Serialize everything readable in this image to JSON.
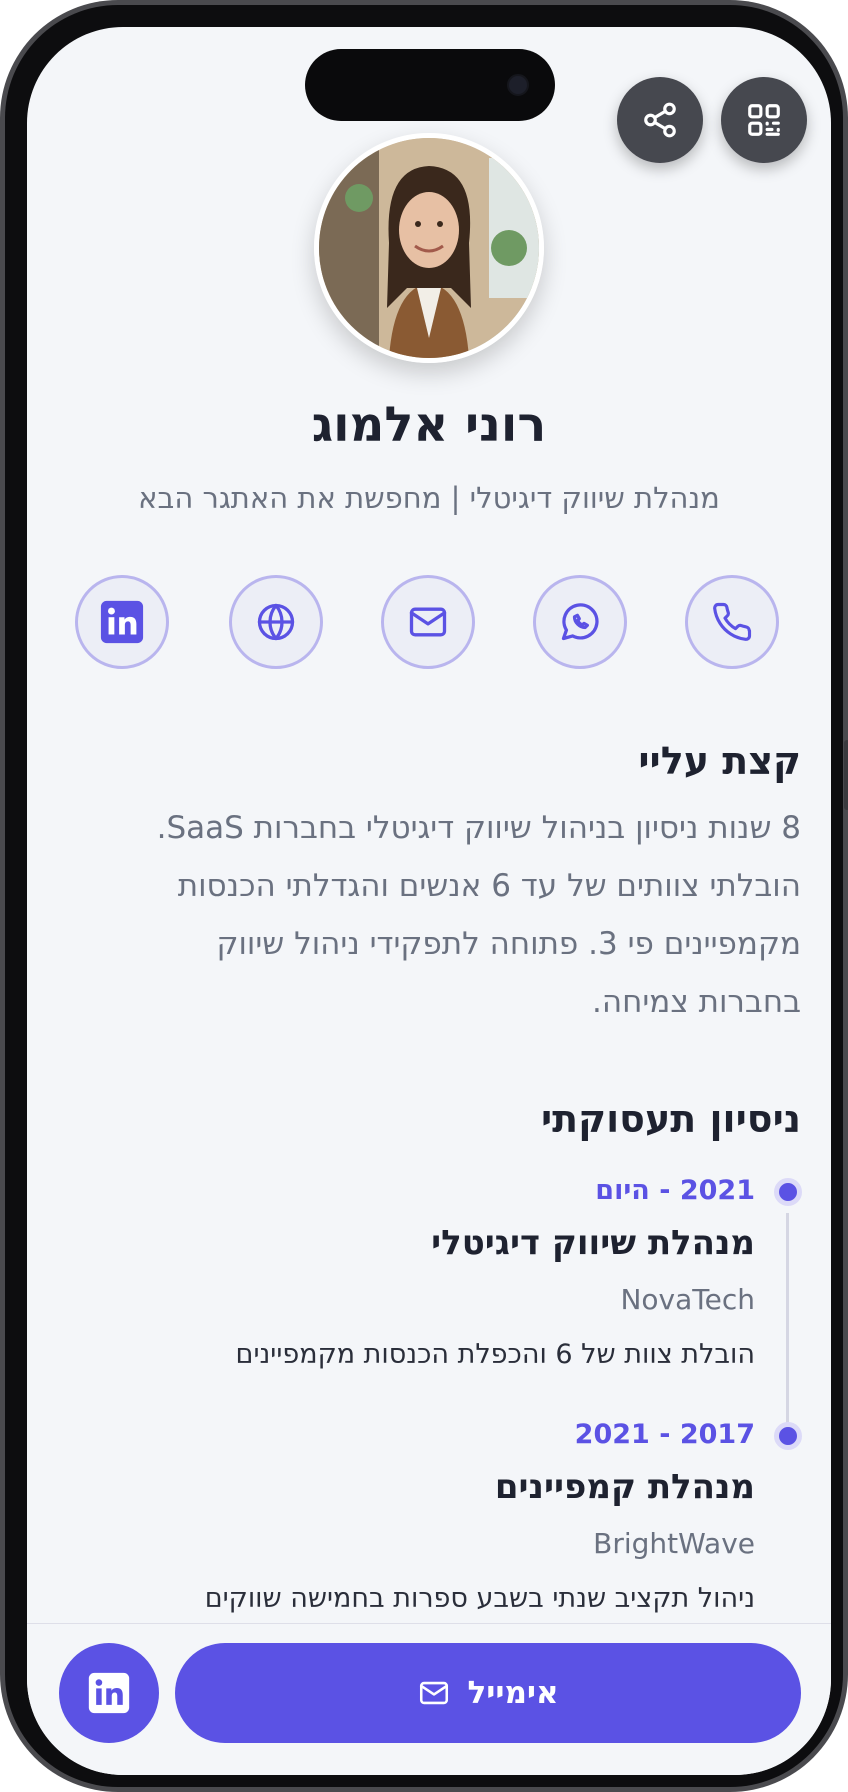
{
  "profile": {
    "name": "רוני אלמוג",
    "tagline": "מנהלת שיווק דיגיטלי | מחפשת את האתגר הבא"
  },
  "top_actions": {
    "share_icon": "share-icon",
    "qr_icon": "qr-code-icon"
  },
  "contacts": [
    {
      "icon": "phone-icon"
    },
    {
      "icon": "whatsapp-icon"
    },
    {
      "icon": "mail-icon"
    },
    {
      "icon": "globe-icon"
    },
    {
      "icon": "linkedin-icon"
    }
  ],
  "about": {
    "title": "קצת עליי",
    "lines": [
      "8 שנות ניסיון בניהול שיווק דיגיטלי בחברות SaaS.",
      "הובלתי צוותים של עד 6 אנשים והגדלתי הכנסות",
      "מקמפיינים פי 3. פתוחה לתפקידי ניהול שיווק",
      "בחברות צמיחה."
    ]
  },
  "experience": {
    "title": "ניסיון תעסוקתי",
    "items": [
      {
        "period": "2021 - היום",
        "title": "מנהלת שיווק דיגיטלי",
        "company": "NovaTech",
        "description": "הובלת צוות של 6 והכפלת הכנסות מקמפיינים"
      },
      {
        "period": "2017 - 2021",
        "title": "מנהלת קמפיינים",
        "company": "BrightWave",
        "description": "ניהול תקציב שנתי בשבע ספרות בחמישה שווקים"
      }
    ]
  },
  "bottom": {
    "email_label": "אימייל"
  },
  "colors": {
    "accent": "#5b52e4",
    "text": "#1e2230",
    "muted": "#6a7180",
    "bg": "#f4f6f9"
  }
}
